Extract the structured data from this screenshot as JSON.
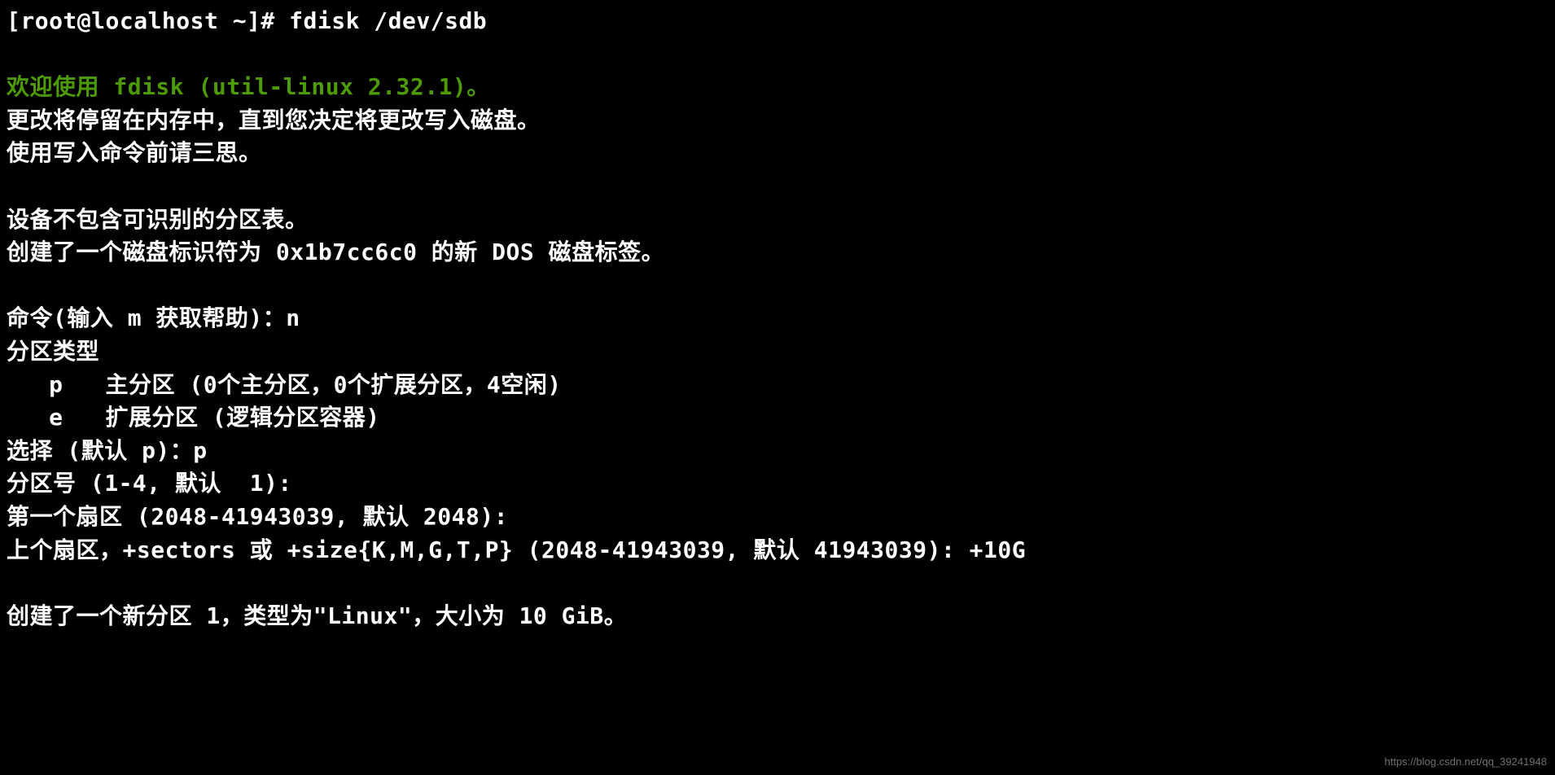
{
  "terminal": {
    "prompt": "[root@localhost ~]# ",
    "command": "fdisk /dev/sdb",
    "welcome": "欢迎使用 fdisk (util-linux 2.32.1)。",
    "info1": "更改将停留在内存中，直到您决定将更改写入磁盘。",
    "info2": "使用写入命令前请三思。",
    "notice1": "设备不包含可识别的分区表。",
    "notice2": "创建了一个磁盘标识符为 0x1b7cc6c0 的新 DOS 磁盘标签。",
    "cmd_prompt": "命令(输入 m 获取帮助)：n",
    "part_type_header": "分区类型",
    "part_type_p": "   p   主分区 (0个主分区，0个扩展分区，4空闲)",
    "part_type_e": "   e   扩展分区 (逻辑分区容器)",
    "select": "选择 (默认 p)：p",
    "part_num": "分区号 (1-4, 默认  1):",
    "first_sector": "第一个扇区 (2048-41943039, 默认 2048):",
    "last_sector": "上个扇区，+sectors 或 +size{K,M,G,T,P} (2048-41943039, 默认 41943039): +10G",
    "created": "创建了一个新分区 1，类型为\"Linux\"，大小为 10 GiB。"
  },
  "watermark": "https://blog.csdn.net/qq_39241948"
}
